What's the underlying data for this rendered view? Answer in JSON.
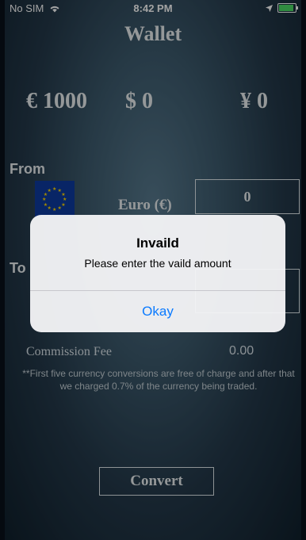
{
  "status_bar": {
    "carrier": "No SIM",
    "wifi_icon": "wifi-icon",
    "time": "8:42 PM",
    "location_icon": "location-arrow-icon",
    "battery_level": 1.0,
    "battery_color": "#4cd964"
  },
  "header": {
    "title": "Wallet"
  },
  "balances": {
    "euro": "€ 1000",
    "dollar": "$ 0",
    "yen": "¥ 0"
  },
  "converter": {
    "from_label": "From",
    "from_flag": "eu-flag",
    "from_currency": "Euro (€)",
    "from_amount": "0",
    "to_label": "To",
    "to_amount": ""
  },
  "commission": {
    "label": "Commission Fee",
    "value": "0.00",
    "note": "**First five currency conversions are free of charge and after that we charged 0.7% of the currency being traded."
  },
  "convert_button": {
    "label": "Convert"
  },
  "alert": {
    "title": "Invaild",
    "message": "Please enter the vaild amount",
    "button": "Okay",
    "button_color": "#0a7aff"
  }
}
